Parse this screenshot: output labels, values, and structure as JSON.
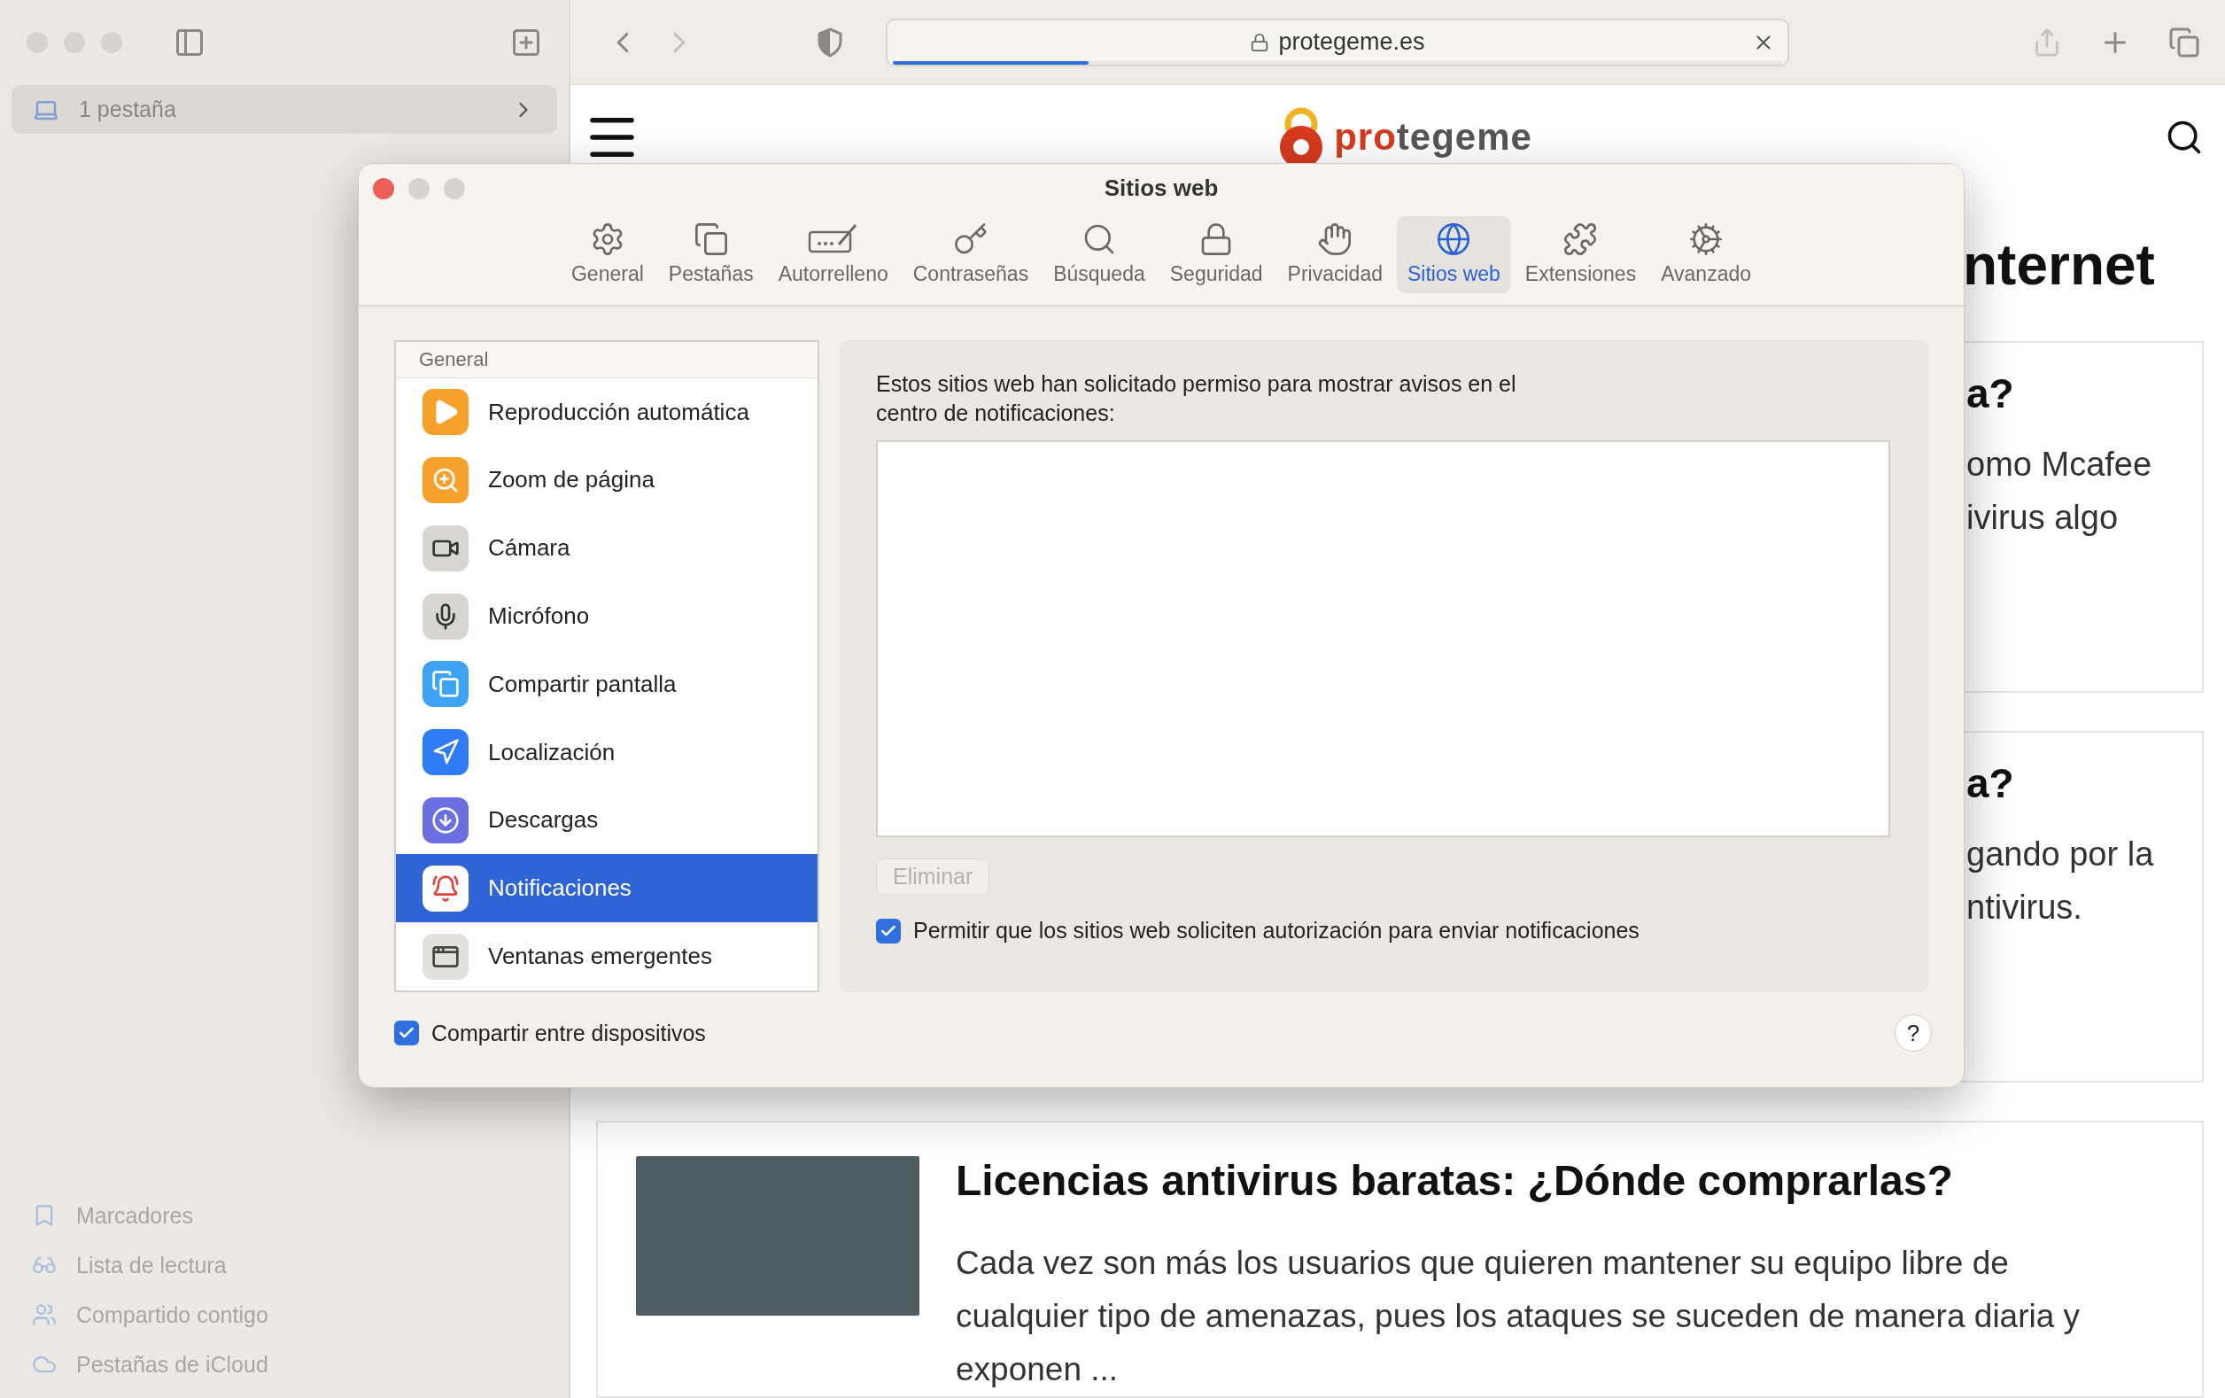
{
  "sidebar": {
    "tab_group": "1 pestaña",
    "items": [
      {
        "label": "Marcadores"
      },
      {
        "label": "Lista de lectura"
      },
      {
        "label": "Compartido contigo"
      },
      {
        "label": "Pestañas de iCloud"
      }
    ]
  },
  "toolbar": {
    "address": "protegeme.es",
    "level": 0.22
  },
  "webpage": {
    "logo_accent": "pro",
    "logo_rest": "tegeme",
    "heading": "nternet",
    "cards": [
      {
        "title": "a?",
        "lines": [
          "omo Mcafee",
          "ivirus algo"
        ]
      },
      {
        "title": "a?",
        "lines": [
          "gando por la",
          "ntivirus."
        ]
      }
    ],
    "article": {
      "title": "Licencias antivirus baratas: ¿Dónde comprarlas?",
      "body": "Cada vez son más los usuarios que quieren mantener su equipo libre de cualquier tipo de amenazas, pues los ataques se suceden de manera diaria y exponen ..."
    }
  },
  "dialog": {
    "title": "Sitios web",
    "tabs": [
      {
        "label": "General",
        "selected": false
      },
      {
        "label": "Pestañas",
        "selected": false
      },
      {
        "label": "Autorrelleno",
        "selected": false
      },
      {
        "label": "Contraseñas",
        "selected": false
      },
      {
        "label": "Búsqueda",
        "selected": false
      },
      {
        "label": "Seguridad",
        "selected": false
      },
      {
        "label": "Privacidad",
        "selected": false
      },
      {
        "label": "Sitios web",
        "selected": true
      },
      {
        "label": "Extensiones",
        "selected": false
      },
      {
        "label": "Avanzado",
        "selected": false
      }
    ],
    "list_header": "General",
    "list": [
      {
        "label": "Reproducción automática",
        "selected": false
      },
      {
        "label": "Zoom de página",
        "selected": false
      },
      {
        "label": "Cámara",
        "selected": false
      },
      {
        "label": "Micrófono",
        "selected": false
      },
      {
        "label": "Compartir pantalla",
        "selected": false
      },
      {
        "label": "Localización",
        "selected": false
      },
      {
        "label": "Descargas",
        "selected": false
      },
      {
        "label": "Notificaciones",
        "selected": true
      },
      {
        "label": "Ventanas emergentes",
        "selected": false
      }
    ],
    "message": "Estos sitios web han solicitado permiso para mostrar avisos en el centro de notificaciones:",
    "remove_button": {
      "label": "Eliminar",
      "disabled": true
    },
    "allow": {
      "label": "Permitir que los sitios web soliciten autorización para enviar notificaciones",
      "checked": true
    },
    "share": {
      "label": "Compartir entre dispositivos",
      "checked": true
    },
    "help": "?"
  }
}
